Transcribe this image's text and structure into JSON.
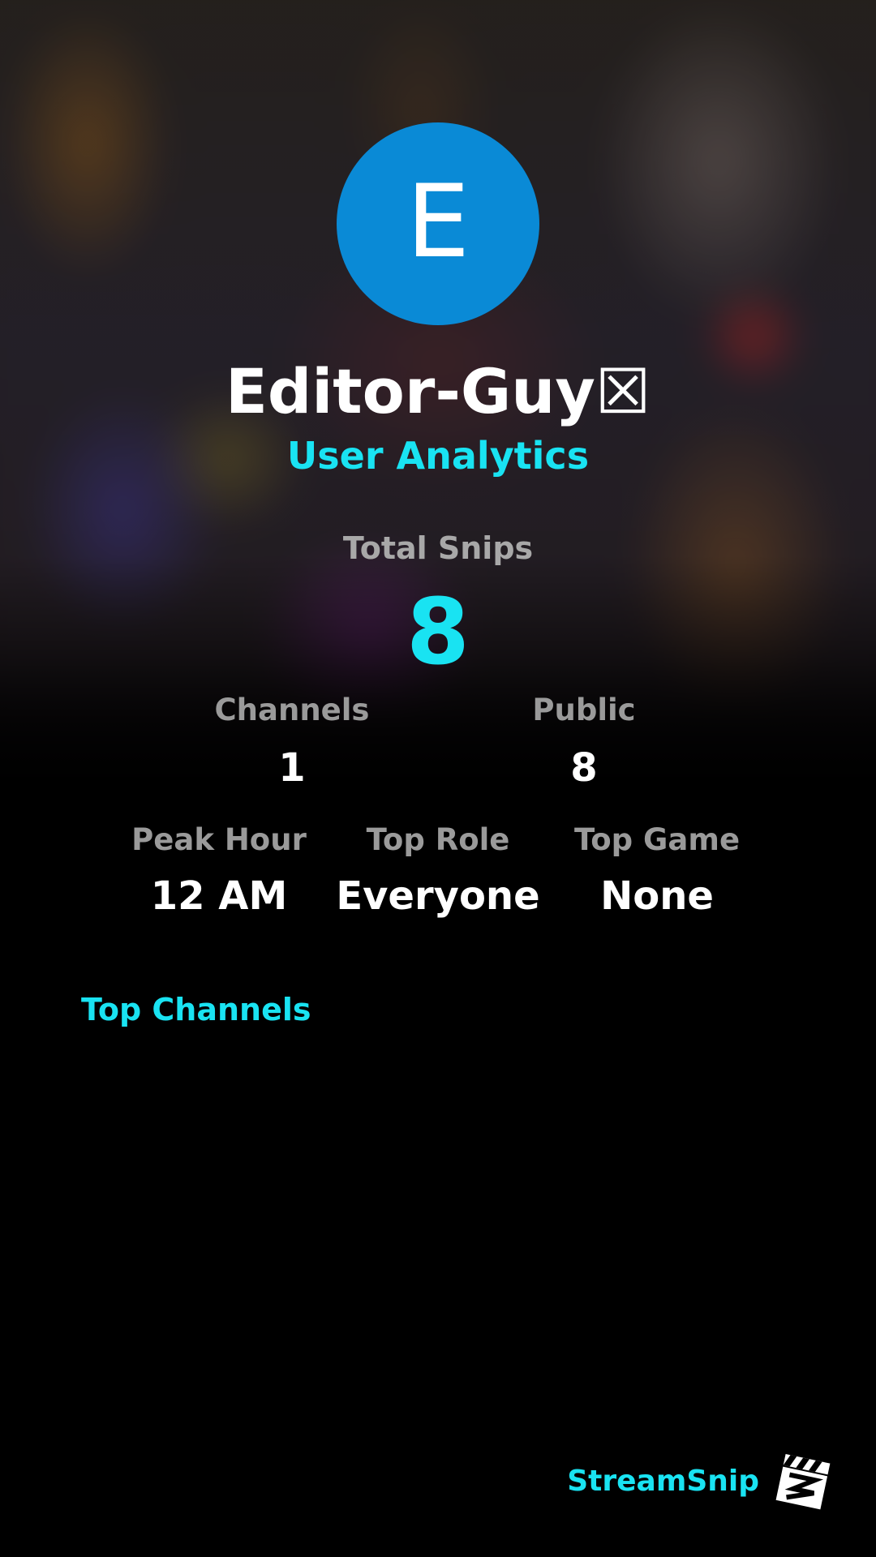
{
  "profile": {
    "avatar_letter": "E",
    "avatar_color": "#0a8ad6",
    "username": "Editor-Guy☒",
    "subtitle": "User Analytics"
  },
  "totals": {
    "label": "Total Snips",
    "value": "8"
  },
  "stats_row1": [
    {
      "label": "Channels",
      "value": "1"
    },
    {
      "label": "Public",
      "value": "8"
    }
  ],
  "stats_row2": [
    {
      "label": "Peak Hour",
      "value": "12 AM"
    },
    {
      "label": "Top Role",
      "value": "Everyone"
    },
    {
      "label": "Top Game",
      "value": "None"
    }
  ],
  "sections": {
    "top_channels_title": "Top Channels"
  },
  "brand": {
    "name": "StreamSnip",
    "logo_icon": "clapperboard-icon"
  },
  "colors": {
    "accent": "#19e3f2",
    "label_gray": "#9a9a9a",
    "background": "#000000"
  }
}
